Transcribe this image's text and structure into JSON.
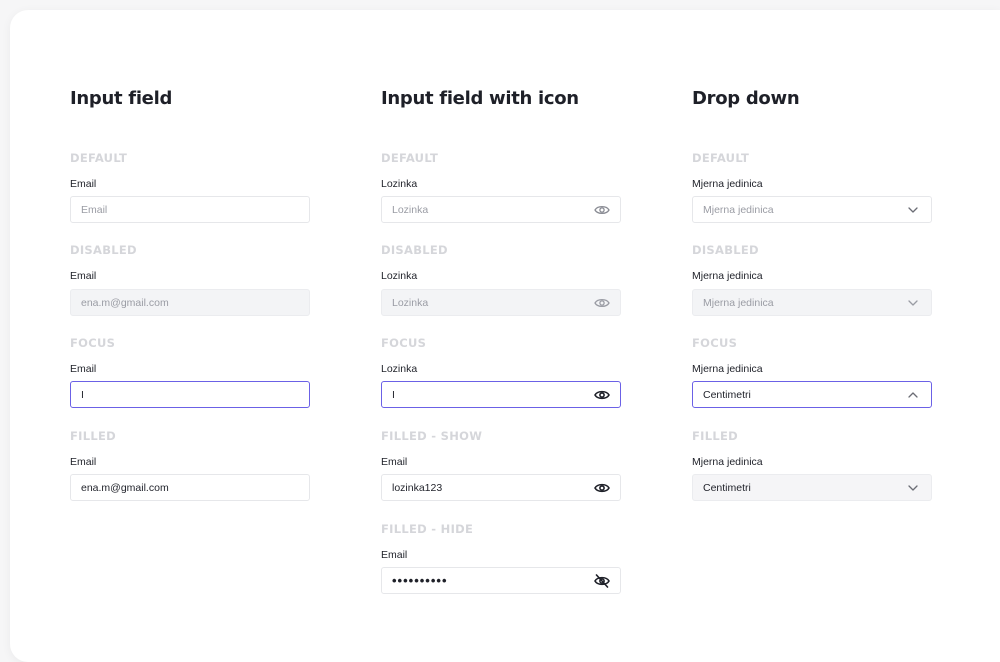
{
  "columns": [
    {
      "title": "Input field",
      "states": [
        {
          "state": "DEFAULT",
          "label": "Email",
          "value": "Email"
        },
        {
          "state": "DISABLED",
          "label": "Email",
          "value": "ena.m@gmail.com"
        },
        {
          "state": "FOCUS",
          "label": "Email",
          "value": "I"
        },
        {
          "state": "FILLED",
          "label": "Email",
          "value": "ena.m@gmail.com"
        }
      ]
    },
    {
      "title": "Input field with icon",
      "states": [
        {
          "state": "DEFAULT",
          "label": "Lozinka",
          "value": "Lozinka",
          "icon": "eye-icon"
        },
        {
          "state": "DISABLED",
          "label": "Lozinka",
          "value": "Lozinka",
          "icon": "eye-icon"
        },
        {
          "state": "FOCUS",
          "label": "Lozinka",
          "value": "I",
          "icon": "eye-icon"
        },
        {
          "state": "FILLED - SHOW",
          "label": "Email",
          "value": "lozinka123",
          "icon": "eye-icon"
        },
        {
          "state": "FILLED - HIDE",
          "label": "Email",
          "value": "••••••••••",
          "icon": "eye-off-icon"
        }
      ]
    },
    {
      "title": "Drop down",
      "states": [
        {
          "state": "DEFAULT",
          "label": "Mjerna jedinica",
          "value": "Mjerna jedinica",
          "icon": "chevron-down-icon"
        },
        {
          "state": "DISABLED",
          "label": "Mjerna jedinica",
          "value": "Mjerna jedinica",
          "icon": "chevron-down-icon"
        },
        {
          "state": "FOCUS",
          "label": "Mjerna jedinica",
          "value": "Centimetri",
          "icon": "chevron-up-icon"
        },
        {
          "state": "FILLED",
          "label": "Mjerna jedinica",
          "value": "Centimetri",
          "icon": "chevron-down-icon"
        }
      ]
    }
  ],
  "colors": {
    "focus_border": "#6b61e6",
    "state_heading": "#d5d6da",
    "disabled_bg": "#f3f4f6"
  }
}
